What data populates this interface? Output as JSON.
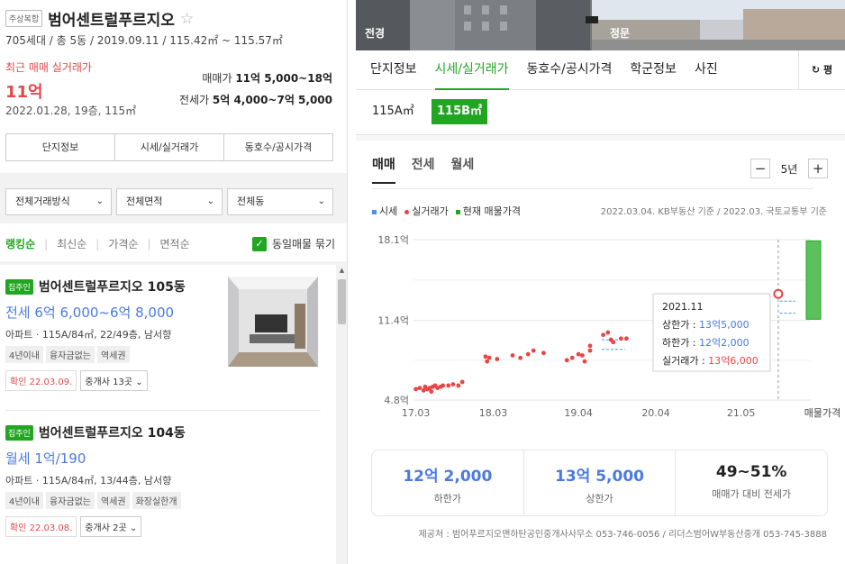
{
  "complex": {
    "type_badge": "주상복합",
    "name": "범어센트럴푸르지오",
    "star": "☆",
    "subinfo": "705세대 / 총 5동 / 2019.09.11 / 115.42㎡ ~ 115.57㎡",
    "recent_label": "최근 매매 실거래가",
    "recent_price": "11억",
    "recent_date": "2022.01.28, 19층, 115㎡",
    "sale_label": "매매가",
    "sale_range": "11억 5,000~18억",
    "jeonse_label": "전세가",
    "jeonse_range": "5억 4,000~7억 5,000"
  },
  "left_tabs": [
    "단지정보",
    "시세/실거래가",
    "동호수/공시가격"
  ],
  "filters": [
    "전체거래방식",
    "전체면적",
    "전체동"
  ],
  "sort": {
    "items": [
      "랭킹순",
      "최신순",
      "가격순",
      "면적순"
    ],
    "active": "랭킹순",
    "merge_label": "동일매물 묶기",
    "checkmark": "✓"
  },
  "listings": [
    {
      "badge": "집주인",
      "title": "범어센트럴푸르지오 105동",
      "price": "전세 6억 6,000~6억 8,000",
      "spec": "아파트 · 115A/84㎡, 22/49층, 남서향",
      "tags": [
        "4년이내",
        "융자금없는",
        "역세권"
      ],
      "confirm": "확인 22.03.09.",
      "agent": "중개사 13곳"
    },
    {
      "badge": "집주인",
      "title": "범어센트럴푸르지오 104동",
      "price": "월세 1억/190",
      "spec": "아파트 · 115A/84㎡, 13/44층, 남서향",
      "tags": [
        "4년이내",
        "융자금없는",
        "역세권",
        "화장실한개"
      ],
      "confirm": "확인 22.03.08.",
      "agent": "중개사 2곳"
    }
  ],
  "photos": [
    "전경",
    "정문"
  ],
  "main_tabs": [
    "단지정보",
    "시세/실거래가",
    "동호수/공시가격",
    "학군정보",
    "사진"
  ],
  "main_tab_active": "시세/실거래가",
  "refresh_label": "평",
  "areas": [
    "115A㎡",
    "115B㎡"
  ],
  "area_active": "115B㎡",
  "mode_tabs": [
    "매매",
    "전세",
    "월세"
  ],
  "mode_active": "매매",
  "period": {
    "minus": "−",
    "value": "5년",
    "plus": "+"
  },
  "legend": [
    {
      "label": "시세",
      "color": "#4a90e2"
    },
    {
      "label": "실거래가",
      "color": "#e84545"
    },
    {
      "label": "현재 매물가격",
      "color": "#21a621"
    }
  ],
  "source_note": "2022.03.04. KB부동산 기준 / 2022.03. 국토교통부 기준",
  "chart_data": {
    "type": "scatter",
    "yticks": [
      "18.1억",
      "11.4억",
      "4.8억"
    ],
    "ytick_values": [
      18.1,
      11.4,
      4.8
    ],
    "xticks": [
      "17.03",
      "18.03",
      "19.04",
      "20.04",
      "21.05",
      "매물가격"
    ],
    "ylim": [
      4.8,
      18.1
    ],
    "xlim": [
      2017.17,
      2022.3
    ],
    "series": [
      {
        "name": "실거래가",
        "color": "#e84545",
        "points": [
          [
            2017.2,
            5.7
          ],
          [
            2017.25,
            5.8
          ],
          [
            2017.3,
            5.6
          ],
          [
            2017.32,
            5.9
          ],
          [
            2017.35,
            5.7
          ],
          [
            2017.38,
            5.8
          ],
          [
            2017.4,
            5.5
          ],
          [
            2017.42,
            5.9
          ],
          [
            2017.45,
            6.0
          ],
          [
            2017.48,
            5.8
          ],
          [
            2017.52,
            5.9
          ],
          [
            2017.55,
            6.0
          ],
          [
            2017.62,
            6.0
          ],
          [
            2017.68,
            6.1
          ],
          [
            2017.75,
            6.0
          ],
          [
            2017.8,
            6.3
          ],
          [
            2018.1,
            8.4
          ],
          [
            2018.12,
            8.0
          ],
          [
            2018.15,
            8.3
          ],
          [
            2018.25,
            8.2
          ],
          [
            2018.45,
            8.5
          ],
          [
            2018.55,
            8.3
          ],
          [
            2018.65,
            8.6
          ],
          [
            2018.72,
            8.9
          ],
          [
            2018.85,
            8.7
          ],
          [
            2019.15,
            8.1
          ],
          [
            2019.22,
            8.3
          ],
          [
            2019.3,
            8.6
          ],
          [
            2019.35,
            8.5
          ],
          [
            2019.38,
            8.0
          ],
          [
            2019.45,
            8.9
          ],
          [
            2019.45,
            9.3
          ],
          [
            2019.62,
            10.2
          ],
          [
            2019.68,
            10.4
          ],
          [
            2019.72,
            9.8
          ],
          [
            2019.75,
            9.6
          ],
          [
            2019.85,
            9.9
          ],
          [
            2019.92,
            9.9
          ]
        ]
      },
      {
        "name": "시세",
        "color": "#4a90e2",
        "points": [
          [
            2019.6,
            9.0
          ],
          [
            2019.9,
            9.0
          ],
          [
            2019.6,
            9.8
          ],
          [
            2019.9,
            9.8
          ],
          [
            2021.9,
            12.0
          ],
          [
            2022.1,
            12.0
          ],
          [
            2021.9,
            13.0
          ],
          [
            2022.1,
            13.0
          ]
        ]
      },
      {
        "name": "현재 매물가격",
        "color": "#21a621",
        "range": [
          11.5,
          18.0
        ]
      }
    ],
    "tooltip": {
      "date": "2021.11",
      "upper_label": "상한가 :",
      "upper_value": "13억5,000",
      "lower_label": "하한가 :",
      "lower_value": "12억2,000",
      "real_label": "실거래가 :",
      "real_value": "13억6,000",
      "point": [
        2021.88,
        13.6
      ]
    }
  },
  "summary": [
    {
      "value": "12억 2,000",
      "label": "하한가"
    },
    {
      "value": "13억 5,000",
      "label": "상한가"
    },
    {
      "value": "49~51%",
      "label": "매매가 대비 전세가"
    }
  ],
  "footer": "제공처 : 범어푸르지오맨하탄공인중개사사무소 053-746-0056 / 리더스범어W부동산중개 053-745-3888"
}
